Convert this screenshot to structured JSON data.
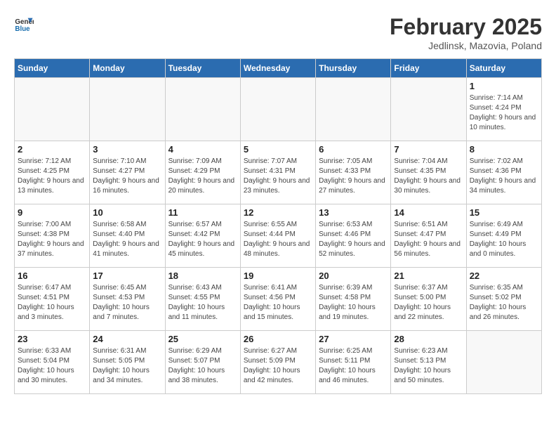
{
  "header": {
    "logo_general": "General",
    "logo_blue": "Blue",
    "month_title": "February 2025",
    "subtitle": "Jedlinsk, Mazovia, Poland"
  },
  "weekdays": [
    "Sunday",
    "Monday",
    "Tuesday",
    "Wednesday",
    "Thursday",
    "Friday",
    "Saturday"
  ],
  "weeks": [
    [
      {
        "day": "",
        "info": ""
      },
      {
        "day": "",
        "info": ""
      },
      {
        "day": "",
        "info": ""
      },
      {
        "day": "",
        "info": ""
      },
      {
        "day": "",
        "info": ""
      },
      {
        "day": "",
        "info": ""
      },
      {
        "day": "1",
        "info": "Sunrise: 7:14 AM\nSunset: 4:24 PM\nDaylight: 9 hours\nand 10 minutes."
      }
    ],
    [
      {
        "day": "2",
        "info": "Sunrise: 7:12 AM\nSunset: 4:25 PM\nDaylight: 9 hours\nand 13 minutes."
      },
      {
        "day": "3",
        "info": "Sunrise: 7:10 AM\nSunset: 4:27 PM\nDaylight: 9 hours\nand 16 minutes."
      },
      {
        "day": "4",
        "info": "Sunrise: 7:09 AM\nSunset: 4:29 PM\nDaylight: 9 hours\nand 20 minutes."
      },
      {
        "day": "5",
        "info": "Sunrise: 7:07 AM\nSunset: 4:31 PM\nDaylight: 9 hours\nand 23 minutes."
      },
      {
        "day": "6",
        "info": "Sunrise: 7:05 AM\nSunset: 4:33 PM\nDaylight: 9 hours\nand 27 minutes."
      },
      {
        "day": "7",
        "info": "Sunrise: 7:04 AM\nSunset: 4:35 PM\nDaylight: 9 hours\nand 30 minutes."
      },
      {
        "day": "8",
        "info": "Sunrise: 7:02 AM\nSunset: 4:36 PM\nDaylight: 9 hours\nand 34 minutes."
      }
    ],
    [
      {
        "day": "9",
        "info": "Sunrise: 7:00 AM\nSunset: 4:38 PM\nDaylight: 9 hours\nand 37 minutes."
      },
      {
        "day": "10",
        "info": "Sunrise: 6:58 AM\nSunset: 4:40 PM\nDaylight: 9 hours\nand 41 minutes."
      },
      {
        "day": "11",
        "info": "Sunrise: 6:57 AM\nSunset: 4:42 PM\nDaylight: 9 hours\nand 45 minutes."
      },
      {
        "day": "12",
        "info": "Sunrise: 6:55 AM\nSunset: 4:44 PM\nDaylight: 9 hours\nand 48 minutes."
      },
      {
        "day": "13",
        "info": "Sunrise: 6:53 AM\nSunset: 4:46 PM\nDaylight: 9 hours\nand 52 minutes."
      },
      {
        "day": "14",
        "info": "Sunrise: 6:51 AM\nSunset: 4:47 PM\nDaylight: 9 hours\nand 56 minutes."
      },
      {
        "day": "15",
        "info": "Sunrise: 6:49 AM\nSunset: 4:49 PM\nDaylight: 10 hours\nand 0 minutes."
      }
    ],
    [
      {
        "day": "16",
        "info": "Sunrise: 6:47 AM\nSunset: 4:51 PM\nDaylight: 10 hours\nand 3 minutes."
      },
      {
        "day": "17",
        "info": "Sunrise: 6:45 AM\nSunset: 4:53 PM\nDaylight: 10 hours\nand 7 minutes."
      },
      {
        "day": "18",
        "info": "Sunrise: 6:43 AM\nSunset: 4:55 PM\nDaylight: 10 hours\nand 11 minutes."
      },
      {
        "day": "19",
        "info": "Sunrise: 6:41 AM\nSunset: 4:56 PM\nDaylight: 10 hours\nand 15 minutes."
      },
      {
        "day": "20",
        "info": "Sunrise: 6:39 AM\nSunset: 4:58 PM\nDaylight: 10 hours\nand 19 minutes."
      },
      {
        "day": "21",
        "info": "Sunrise: 6:37 AM\nSunset: 5:00 PM\nDaylight: 10 hours\nand 22 minutes."
      },
      {
        "day": "22",
        "info": "Sunrise: 6:35 AM\nSunset: 5:02 PM\nDaylight: 10 hours\nand 26 minutes."
      }
    ],
    [
      {
        "day": "23",
        "info": "Sunrise: 6:33 AM\nSunset: 5:04 PM\nDaylight: 10 hours\nand 30 minutes."
      },
      {
        "day": "24",
        "info": "Sunrise: 6:31 AM\nSunset: 5:05 PM\nDaylight: 10 hours\nand 34 minutes."
      },
      {
        "day": "25",
        "info": "Sunrise: 6:29 AM\nSunset: 5:07 PM\nDaylight: 10 hours\nand 38 minutes."
      },
      {
        "day": "26",
        "info": "Sunrise: 6:27 AM\nSunset: 5:09 PM\nDaylight: 10 hours\nand 42 minutes."
      },
      {
        "day": "27",
        "info": "Sunrise: 6:25 AM\nSunset: 5:11 PM\nDaylight: 10 hours\nand 46 minutes."
      },
      {
        "day": "28",
        "info": "Sunrise: 6:23 AM\nSunset: 5:13 PM\nDaylight: 10 hours\nand 50 minutes."
      },
      {
        "day": "",
        "info": ""
      }
    ]
  ]
}
